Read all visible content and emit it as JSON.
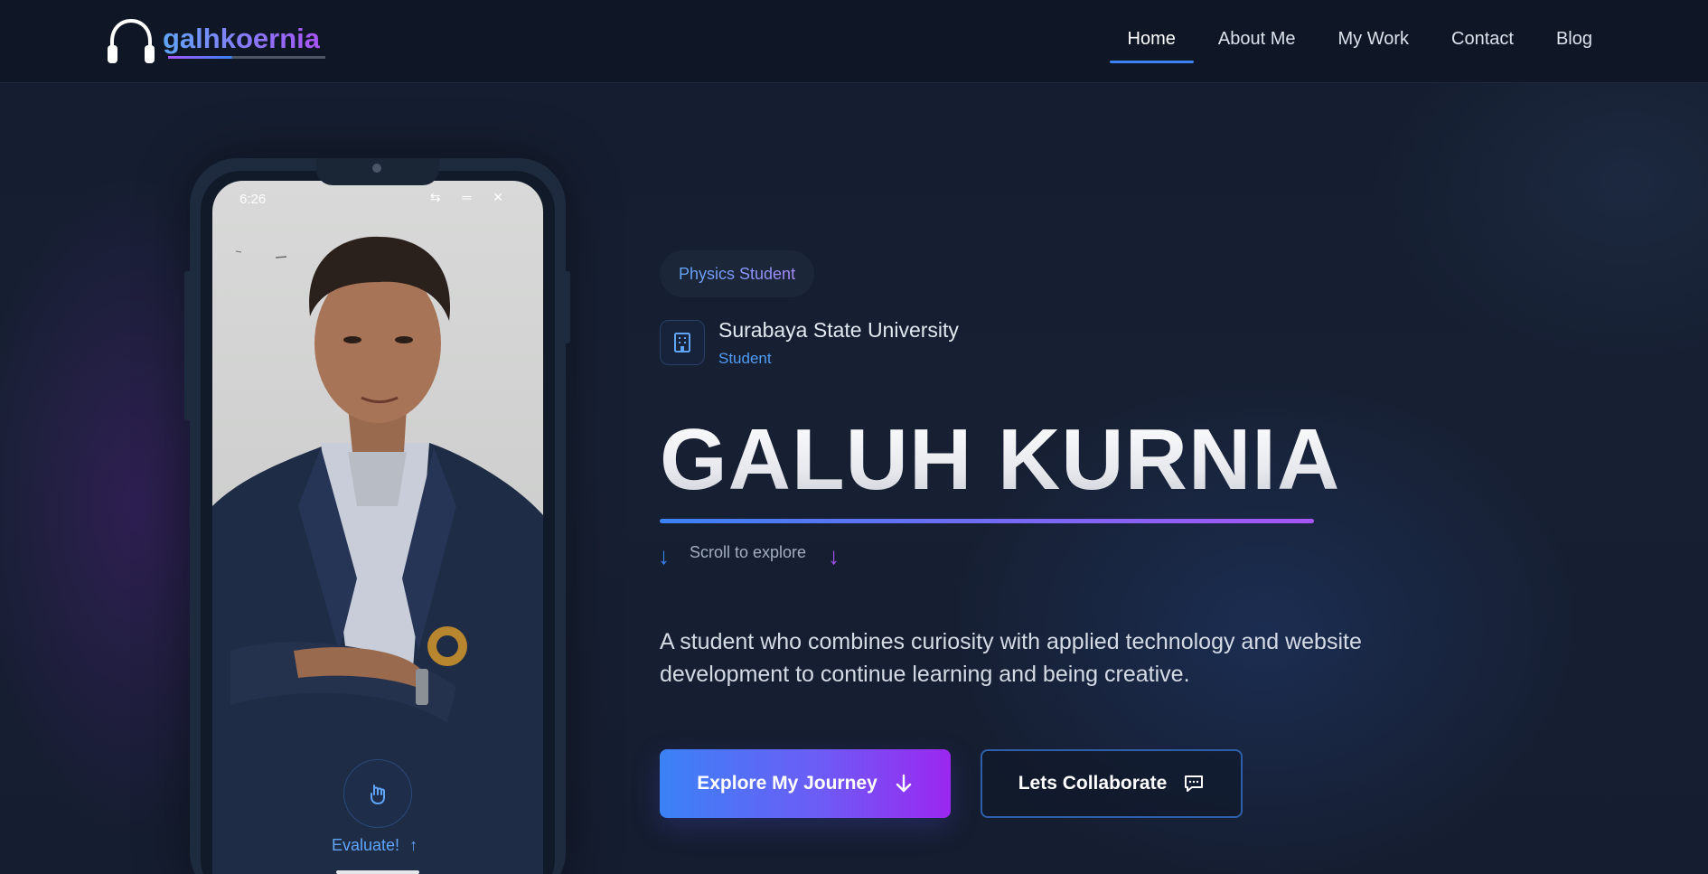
{
  "header": {
    "logo_text": "galhkoernia",
    "nav": [
      {
        "label": "Home",
        "active": true
      },
      {
        "label": "About Me",
        "active": false
      },
      {
        "label": "My Work",
        "active": false
      },
      {
        "label": "Contact",
        "active": false
      },
      {
        "label": "Blog",
        "active": false
      }
    ]
  },
  "phone": {
    "status_time": "6:26",
    "status_icons": "⇆ ═ ✕",
    "evaluate_label": "Evaluate!",
    "evaluate_arrow": "↑"
  },
  "hero": {
    "badge": "Physics Student",
    "university": "Surabaya State University",
    "role": "Student",
    "name": "GALUH KURNIA",
    "scroll_text": "Scroll to explore",
    "scroll_arrow": "↓",
    "description": "A student who combines curiosity with applied technology and website development to continue learning and being creative.",
    "primary_button": "Explore My Journey",
    "secondary_button": "Lets Collaborate"
  },
  "colors": {
    "accent_blue": "#3b82f6",
    "accent_purple": "#a855f7",
    "background": "#111a2b"
  },
  "icons": [
    "headphones-icon",
    "building-icon",
    "arrow-down-icon",
    "chat-icon",
    "hand-tap-icon"
  ]
}
